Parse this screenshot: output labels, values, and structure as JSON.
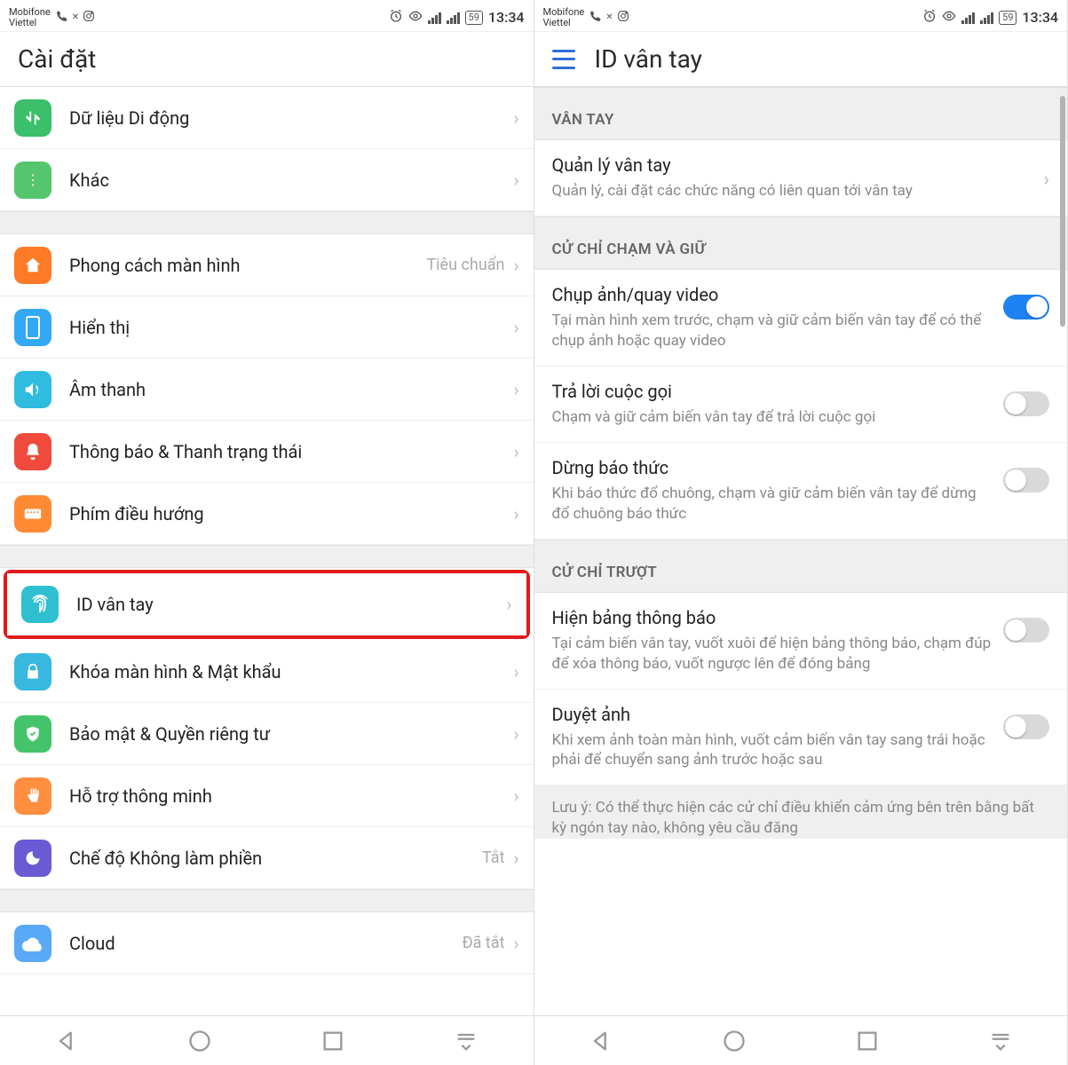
{
  "status": {
    "carrier1": "Mobifone",
    "carrier2": "Viettel",
    "battery": "59",
    "time": "13:34"
  },
  "left": {
    "title": "Cài đặt",
    "rows": [
      {
        "id": "mobile-data",
        "label": "Dữ liệu Di động"
      },
      {
        "id": "other",
        "label": "Khác"
      },
      {
        "id": "screen-style",
        "label": "Phong cách màn hình",
        "value": "Tiêu chuẩn"
      },
      {
        "id": "display",
        "label": "Hiển thị"
      },
      {
        "id": "sound",
        "label": "Âm thanh"
      },
      {
        "id": "notif",
        "label": "Thông báo & Thanh trạng thái"
      },
      {
        "id": "navkeys",
        "label": "Phím điều hướng"
      },
      {
        "id": "fingerprint",
        "label": "ID vân tay"
      },
      {
        "id": "lock",
        "label": "Khóa màn hình & Mật khẩu"
      },
      {
        "id": "security",
        "label": "Bảo mật & Quyền riêng tư"
      },
      {
        "id": "smart",
        "label": "Hỗ trợ thông minh"
      },
      {
        "id": "dnd",
        "label": "Chế độ Không làm phiền",
        "value": "Tắt"
      },
      {
        "id": "cloud",
        "label": "Cloud",
        "value": "Đã tắt"
      }
    ]
  },
  "right": {
    "title": "ID vân tay",
    "sections": [
      {
        "header": "VÂN TAY",
        "items": [
          {
            "id": "manage",
            "title": "Quản lý vân tay",
            "desc": "Quản lý, cài đặt các chức năng có liên quan tới vân tay",
            "type": "chev"
          }
        ]
      },
      {
        "header": "CỬ CHỈ CHẠM VÀ GIỮ",
        "items": [
          {
            "id": "camera",
            "title": "Chụp ảnh/quay video",
            "desc": "Tại màn hình xem trước, chạm và giữ cảm biến vân tay để có thể chụp ảnh hoặc quay video",
            "type": "toggle",
            "on": true
          },
          {
            "id": "answer",
            "title": "Trả lời cuộc gọi",
            "desc": "Chạm và giữ cảm biến vân tay để trả lời cuộc gọi",
            "type": "toggle",
            "on": false
          },
          {
            "id": "stopalarm",
            "title": "Dừng báo thức",
            "desc": "Khi báo thức đổ chuông, chạm và giữ cảm biến vân tay để dừng đổ chuông báo thức",
            "type": "toggle",
            "on": false
          }
        ]
      },
      {
        "header": "CỬ CHỈ TRƯỢT",
        "items": [
          {
            "id": "notifpanel",
            "title": "Hiện bảng thông báo",
            "desc": "Tại cảm biến vân tay, vuốt xuôi để hiện bảng thông báo, chạm đúp để xóa thông báo, vuốt ngược lên để đóng bảng",
            "type": "toggle",
            "on": false
          },
          {
            "id": "browse",
            "title": "Duyệt ảnh",
            "desc": "Khi xem ảnh toàn màn hình, vuốt cảm biến vân tay sang trái hoặc phải để chuyển sang ảnh trước hoặc sau",
            "type": "toggle",
            "on": false
          }
        ],
        "note": "Lưu ý: Có thể thực hiện các cử chỉ điều khiển cảm ứng bên trên bằng bất kỳ ngón tay nào, không yêu cầu đăng"
      }
    ]
  }
}
